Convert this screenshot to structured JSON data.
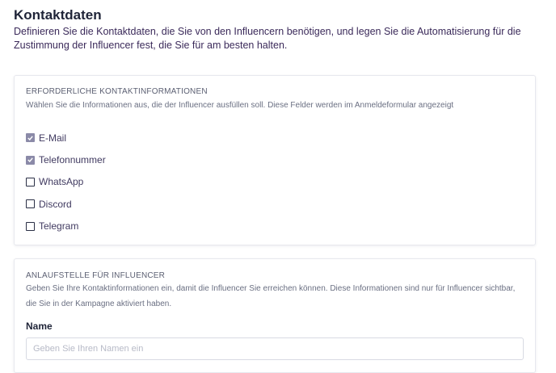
{
  "header": {
    "title": "Kontaktdaten",
    "description": "Definieren Sie die Kontaktdaten, die Sie von den Influencern benötigen, und legen Sie die Automatisierung für die Zustimmung der Influencer fest, die Sie für am besten halten."
  },
  "contact_card": {
    "title": "ERFORDERLICHE KONTAKTINFORMATIONEN",
    "subtitle": "Wählen Sie die Informationen aus, die der Influencer ausfüllen soll. Diese Felder werden im Anmeldeformular angezeigt",
    "options": [
      {
        "label": "E-Mail",
        "checked": true
      },
      {
        "label": "Telefonnummer",
        "checked": true
      },
      {
        "label": "WhatsApp",
        "checked": false
      },
      {
        "label": "Discord",
        "checked": false
      },
      {
        "label": "Telegram",
        "checked": false
      }
    ]
  },
  "contact_person_card": {
    "title": "ANLAUFSTELLE FÜR INFLUENCER",
    "subtitle": "Geben Sie Ihre Kontaktinformationen ein, damit die Influencer Sie erreichen können. Diese Informationen sind nur für Influencer sichtbar, die Sie in der Kampagne aktiviert haben.",
    "name_label": "Name",
    "name_placeholder": "Geben Sie Ihren Namen ein",
    "name_value": ""
  }
}
